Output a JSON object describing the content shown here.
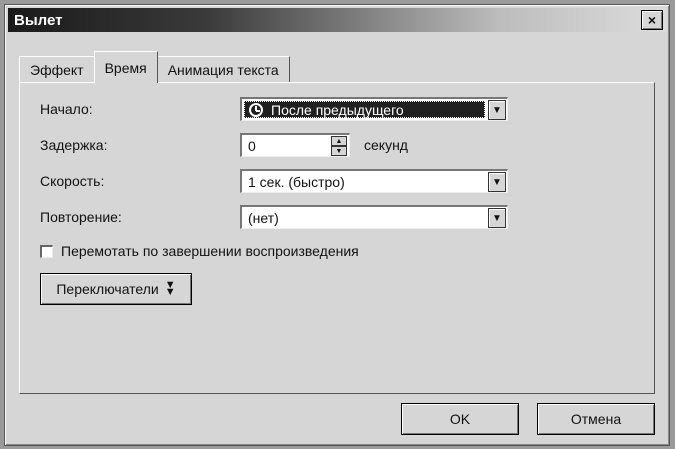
{
  "window": {
    "title": "Вылет",
    "close_glyph": "×"
  },
  "tabs": [
    {
      "label": "Эффект",
      "active": false
    },
    {
      "label": "Время",
      "active": true
    },
    {
      "label": "Анимация текста",
      "active": false
    }
  ],
  "fields": {
    "start": {
      "label": "Начало:",
      "value": "После предыдущего",
      "icon": "clock-icon"
    },
    "delay": {
      "label": "Задержка:",
      "value": "0",
      "unit": "секунд"
    },
    "speed": {
      "label": "Скорость:",
      "value": "1 сек. (быстро)"
    },
    "repeat": {
      "label": "Повторение:",
      "value": "(нет)"
    }
  },
  "rewind_checkbox": {
    "label": "Перемотать по завершении воспроизведения",
    "checked": false
  },
  "triggers_button": {
    "label": "Переключатели"
  },
  "footer": {
    "ok_label": "OK",
    "cancel_label": "Отмена"
  }
}
